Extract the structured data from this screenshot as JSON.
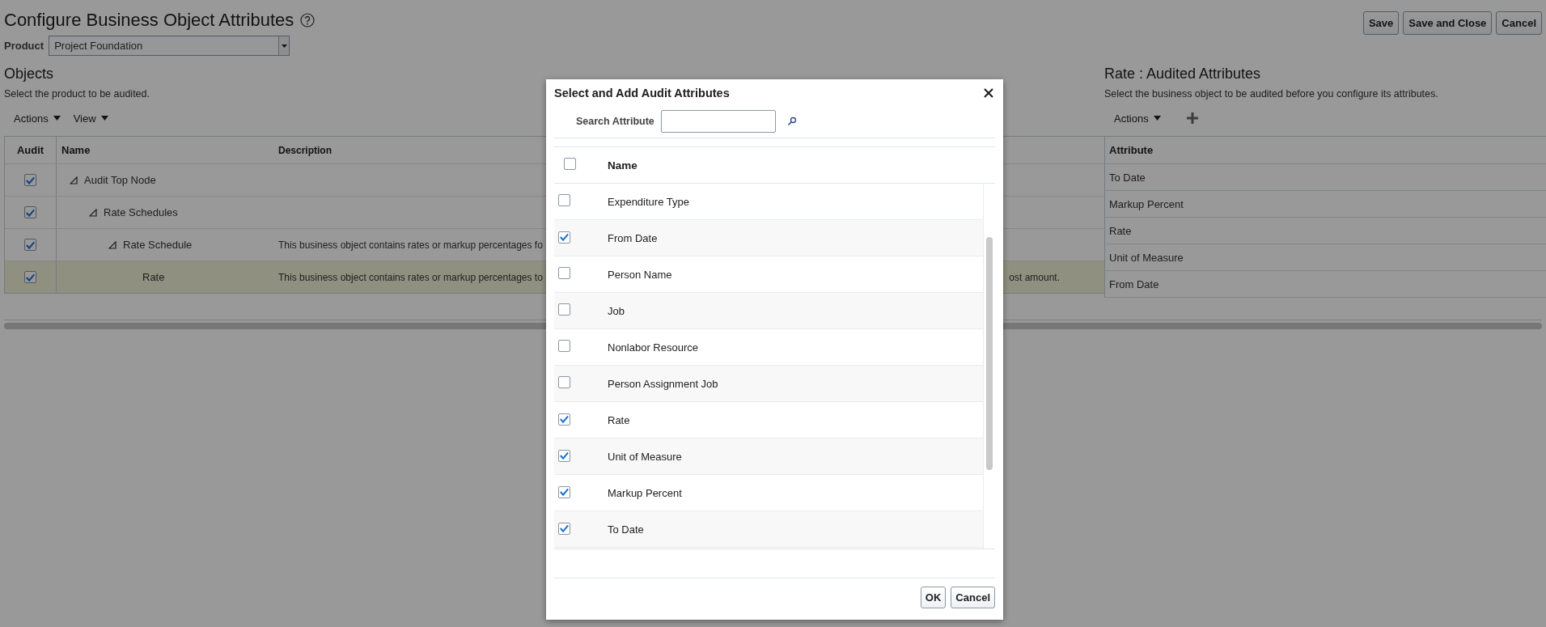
{
  "page": {
    "title": "Configure Business Object Attributes",
    "buttons": [
      "Save",
      "Save and Close",
      "Cancel"
    ]
  },
  "product": {
    "label": "Product",
    "value": "Project Foundation"
  },
  "objects": {
    "title": "Objects",
    "subtitle": "Select the product to be audited.",
    "toolbar": [
      "Actions",
      "View"
    ],
    "columns": [
      "Audit",
      "Name",
      "Description"
    ],
    "rows": [
      {
        "name": "Audit Top Node",
        "audit": true,
        "selected": false,
        "expanded": true,
        "children": [
          {
            "name": "Rate Schedules",
            "audit": true,
            "selected": false,
            "expanded": true,
            "children": [
              {
                "name": "Rate Schedule",
                "audit": true,
                "selected": false,
                "expanded": true,
                "description": [
                  "This business object contains rates or markup percentages fo"
                ],
                "children": [
                  {
                    "name": "Rate",
                    "audit": true,
                    "selected": true,
                    "description": [
                      "This business object contains rates or markup percentages to",
                      "ost amount."
                    ]
                  }
                ]
              }
            ]
          }
        ]
      }
    ]
  },
  "audited": {
    "title": "Rate : Audited Attributes",
    "subtitle": "Select the business object to be audited before you configure its attributes.",
    "toolbar": [
      "Actions"
    ],
    "columns": [
      "Attribute"
    ],
    "rows": [
      "To Date",
      "Markup Percent",
      "Rate",
      "Unit of Measure",
      "From Date"
    ]
  },
  "dialog": {
    "title": "Select and Add Audit Attributes",
    "search_label": "Search Attribute",
    "header": {
      "label": "Name",
      "checked": false
    },
    "rows": [
      {
        "name": "Expenditure Type",
        "checked": false
      },
      {
        "name": "From Date",
        "checked": true
      },
      {
        "name": "Person Name",
        "checked": false
      },
      {
        "name": "Job",
        "checked": false
      },
      {
        "name": "Nonlabor Resource",
        "checked": false
      },
      {
        "name": "Person Assignment Job",
        "checked": false
      },
      {
        "name": "Rate",
        "checked": true
      },
      {
        "name": "Unit of Measure",
        "checked": true
      },
      {
        "name": "Markup Percent",
        "checked": true
      },
      {
        "name": "To Date",
        "checked": true
      }
    ],
    "buttons": [
      "OK",
      "Cancel"
    ]
  }
}
